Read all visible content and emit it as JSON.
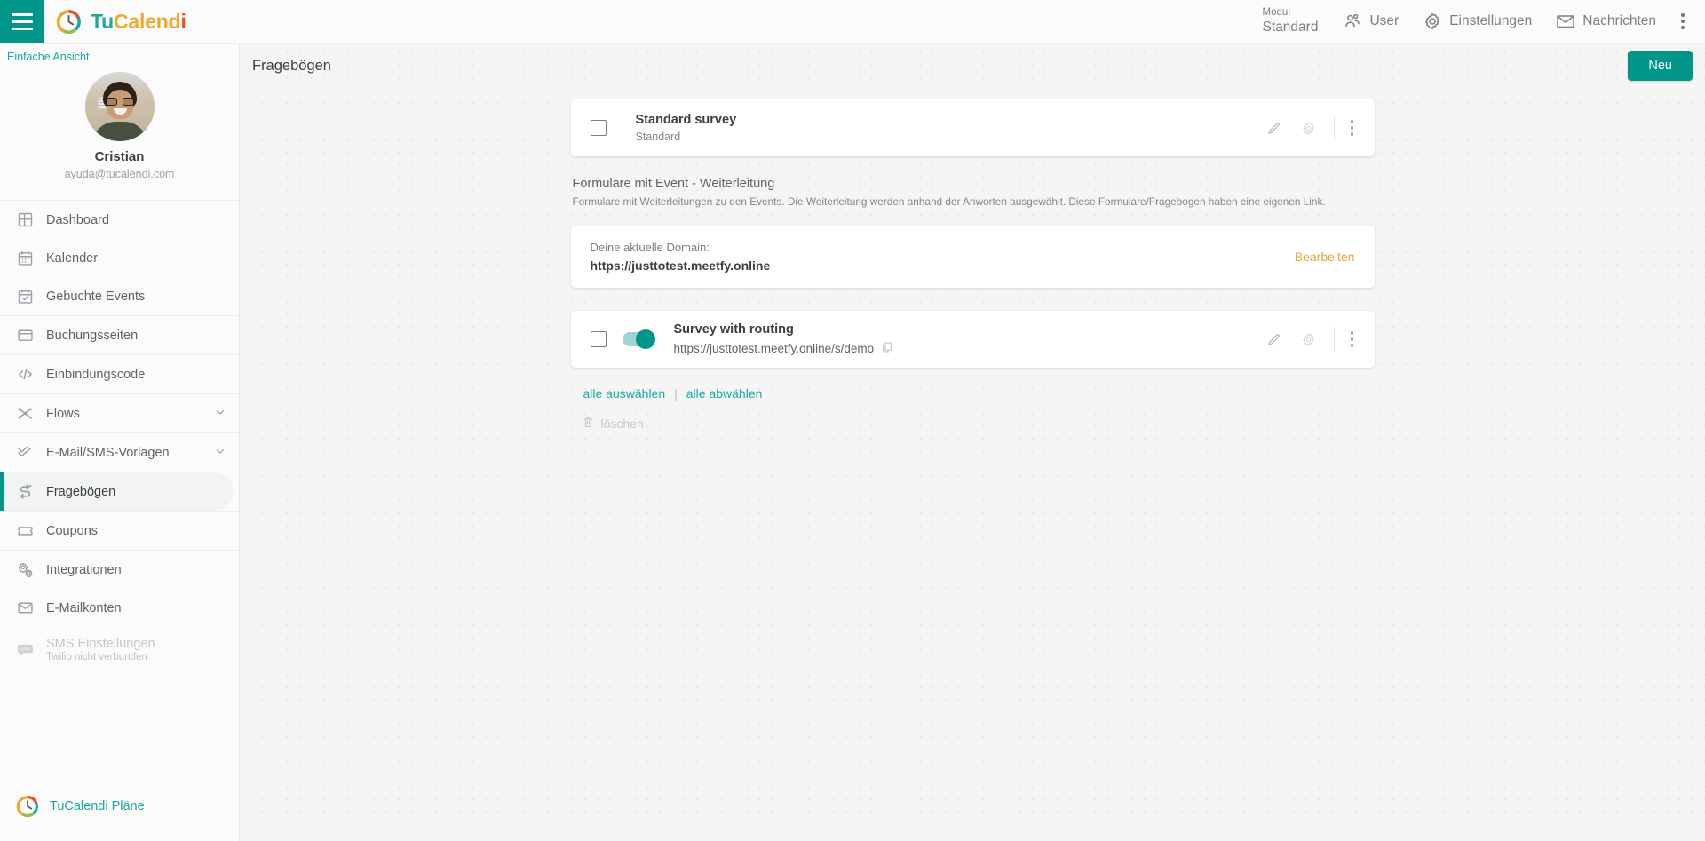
{
  "topbar": {
    "menu_icon": "hamburger-icon",
    "brand": {
      "part1": "Tu",
      "part2": "Calend",
      "part3": "i"
    },
    "module": {
      "label": "Modul",
      "value": "Standard"
    },
    "items": [
      {
        "label": "User",
        "icon": "users-icon"
      },
      {
        "label": "Einstellungen",
        "icon": "gear-icon"
      },
      {
        "label": "Nachrichten",
        "icon": "envelope-icon"
      }
    ],
    "overflow_icon": "kebab-menu-icon"
  },
  "sidebar": {
    "simple_view": "Einfache Ansicht",
    "profile": {
      "name": "Cristian",
      "email": "ayuda@tucalendi.com",
      "avatar": "user-avatar"
    },
    "items": [
      {
        "label": "Dashboard",
        "icon": "dashboard-icon",
        "group": 0
      },
      {
        "label": "Kalender",
        "icon": "calendar-icon",
        "group": 0
      },
      {
        "label": "Gebuchte Events",
        "icon": "calendar-check-icon",
        "group": 0
      },
      {
        "label": "Buchungsseiten",
        "icon": "window-icon",
        "group": 1
      },
      {
        "label": "Einbindungscode",
        "icon": "code-icon",
        "group": 2
      },
      {
        "label": "Flows",
        "icon": "flow-icon",
        "group": 3,
        "chevron": true
      },
      {
        "label": "E-Mail/SMS-Vorlagen",
        "icon": "check-double-icon",
        "group": 4,
        "chevron": true
      },
      {
        "label": "Fragebögen",
        "icon": "survey-icon",
        "group": 5,
        "active": true
      },
      {
        "label": "Coupons",
        "icon": "ticket-icon",
        "group": 6
      },
      {
        "label": "Integrationen",
        "icon": "gears-icon",
        "group": 7
      },
      {
        "label": "E-Mailkonten",
        "icon": "mail-icon",
        "group": 7
      },
      {
        "label": "SMS Einstellungen",
        "sub": "Twilio nicht verbunden",
        "icon": "sms-icon",
        "group": 7,
        "disabled": true
      }
    ],
    "plans": {
      "label": "TuCalendi Pläne",
      "icon": "tucalendi-logo-icon"
    }
  },
  "main": {
    "title": "Fragebögen",
    "new_button": "Neu",
    "standard_survey": {
      "title": "Standard survey",
      "subtitle": "Standard",
      "edit_icon": "pencil-icon",
      "settings_icon": "gear-icon",
      "menu_icon": "kebab-menu-icon"
    },
    "section": {
      "title": "Formulare mit Event - Weiterleitung",
      "description": "Formulare mit Weiterleitungen zu den Events. Die Weiterleitung werden anhand der Anworten ausgewählt. Diese Formulare/Fragebogen haben eine eigenen Link."
    },
    "domain": {
      "label": "Deine aktuelle Domain:",
      "value": "https://justtotest.meetfy.online",
      "edit_link": "Bearbeiten"
    },
    "routing_survey": {
      "title": "Survey with routing",
      "url": "https://justtotest.meetfy.online/s/demo",
      "copy_icon": "copy-icon",
      "toggle_state": "on",
      "edit_icon": "pencil-icon",
      "settings_icon": "gear-icon",
      "menu_icon": "kebab-menu-icon"
    },
    "bulk": {
      "select_all": "alle auswählen",
      "separator": "|",
      "deselect_all": "alle abwählen",
      "delete": "löschen",
      "delete_icon": "trash-icon"
    }
  },
  "colors": {
    "accent_teal": "#00968a",
    "link_teal": "#1aa8a0",
    "warning_orange": "#e8a33d",
    "logo_orange": "#f0a830",
    "logo_red": "#e8502a"
  }
}
